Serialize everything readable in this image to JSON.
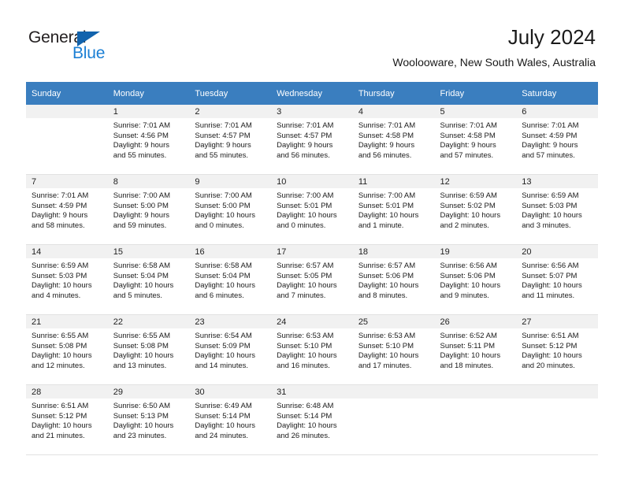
{
  "brand": {
    "name_top": "General",
    "name_bottom": "Blue",
    "triangle_icon": "triangle-icon",
    "color_dark": "#231f20",
    "color_blue": "#1b7fd4",
    "color_triangle": "#1263ad"
  },
  "header": {
    "title": "July 2024",
    "subtitle": "Woolooware, New South Wales, Australia",
    "header_bg": "#3a7ebf",
    "daynum_band_bg": "#f1f1f1"
  },
  "weekdays": [
    "Sunday",
    "Monday",
    "Tuesday",
    "Wednesday",
    "Thursday",
    "Friday",
    "Saturday"
  ],
  "weeks": [
    [
      {
        "day": "",
        "lines": []
      },
      {
        "day": "1",
        "lines": [
          "Sunrise: 7:01 AM",
          "Sunset: 4:56 PM",
          "Daylight: 9 hours",
          "and 55 minutes."
        ]
      },
      {
        "day": "2",
        "lines": [
          "Sunrise: 7:01 AM",
          "Sunset: 4:57 PM",
          "Daylight: 9 hours",
          "and 55 minutes."
        ]
      },
      {
        "day": "3",
        "lines": [
          "Sunrise: 7:01 AM",
          "Sunset: 4:57 PM",
          "Daylight: 9 hours",
          "and 56 minutes."
        ]
      },
      {
        "day": "4",
        "lines": [
          "Sunrise: 7:01 AM",
          "Sunset: 4:58 PM",
          "Daylight: 9 hours",
          "and 56 minutes."
        ]
      },
      {
        "day": "5",
        "lines": [
          "Sunrise: 7:01 AM",
          "Sunset: 4:58 PM",
          "Daylight: 9 hours",
          "and 57 minutes."
        ]
      },
      {
        "day": "6",
        "lines": [
          "Sunrise: 7:01 AM",
          "Sunset: 4:59 PM",
          "Daylight: 9 hours",
          "and 57 minutes."
        ]
      }
    ],
    [
      {
        "day": "7",
        "lines": [
          "Sunrise: 7:01 AM",
          "Sunset: 4:59 PM",
          "Daylight: 9 hours",
          "and 58 minutes."
        ]
      },
      {
        "day": "8",
        "lines": [
          "Sunrise: 7:00 AM",
          "Sunset: 5:00 PM",
          "Daylight: 9 hours",
          "and 59 minutes."
        ]
      },
      {
        "day": "9",
        "lines": [
          "Sunrise: 7:00 AM",
          "Sunset: 5:00 PM",
          "Daylight: 10 hours",
          "and 0 minutes."
        ]
      },
      {
        "day": "10",
        "lines": [
          "Sunrise: 7:00 AM",
          "Sunset: 5:01 PM",
          "Daylight: 10 hours",
          "and 0 minutes."
        ]
      },
      {
        "day": "11",
        "lines": [
          "Sunrise: 7:00 AM",
          "Sunset: 5:01 PM",
          "Daylight: 10 hours",
          "and 1 minute."
        ]
      },
      {
        "day": "12",
        "lines": [
          "Sunrise: 6:59 AM",
          "Sunset: 5:02 PM",
          "Daylight: 10 hours",
          "and 2 minutes."
        ]
      },
      {
        "day": "13",
        "lines": [
          "Sunrise: 6:59 AM",
          "Sunset: 5:03 PM",
          "Daylight: 10 hours",
          "and 3 minutes."
        ]
      }
    ],
    [
      {
        "day": "14",
        "lines": [
          "Sunrise: 6:59 AM",
          "Sunset: 5:03 PM",
          "Daylight: 10 hours",
          "and 4 minutes."
        ]
      },
      {
        "day": "15",
        "lines": [
          "Sunrise: 6:58 AM",
          "Sunset: 5:04 PM",
          "Daylight: 10 hours",
          "and 5 minutes."
        ]
      },
      {
        "day": "16",
        "lines": [
          "Sunrise: 6:58 AM",
          "Sunset: 5:04 PM",
          "Daylight: 10 hours",
          "and 6 minutes."
        ]
      },
      {
        "day": "17",
        "lines": [
          "Sunrise: 6:57 AM",
          "Sunset: 5:05 PM",
          "Daylight: 10 hours",
          "and 7 minutes."
        ]
      },
      {
        "day": "18",
        "lines": [
          "Sunrise: 6:57 AM",
          "Sunset: 5:06 PM",
          "Daylight: 10 hours",
          "and 8 minutes."
        ]
      },
      {
        "day": "19",
        "lines": [
          "Sunrise: 6:56 AM",
          "Sunset: 5:06 PM",
          "Daylight: 10 hours",
          "and 9 minutes."
        ]
      },
      {
        "day": "20",
        "lines": [
          "Sunrise: 6:56 AM",
          "Sunset: 5:07 PM",
          "Daylight: 10 hours",
          "and 11 minutes."
        ]
      }
    ],
    [
      {
        "day": "21",
        "lines": [
          "Sunrise: 6:55 AM",
          "Sunset: 5:08 PM",
          "Daylight: 10 hours",
          "and 12 minutes."
        ]
      },
      {
        "day": "22",
        "lines": [
          "Sunrise: 6:55 AM",
          "Sunset: 5:08 PM",
          "Daylight: 10 hours",
          "and 13 minutes."
        ]
      },
      {
        "day": "23",
        "lines": [
          "Sunrise: 6:54 AM",
          "Sunset: 5:09 PM",
          "Daylight: 10 hours",
          "and 14 minutes."
        ]
      },
      {
        "day": "24",
        "lines": [
          "Sunrise: 6:53 AM",
          "Sunset: 5:10 PM",
          "Daylight: 10 hours",
          "and 16 minutes."
        ]
      },
      {
        "day": "25",
        "lines": [
          "Sunrise: 6:53 AM",
          "Sunset: 5:10 PM",
          "Daylight: 10 hours",
          "and 17 minutes."
        ]
      },
      {
        "day": "26",
        "lines": [
          "Sunrise: 6:52 AM",
          "Sunset: 5:11 PM",
          "Daylight: 10 hours",
          "and 18 minutes."
        ]
      },
      {
        "day": "27",
        "lines": [
          "Sunrise: 6:51 AM",
          "Sunset: 5:12 PM",
          "Daylight: 10 hours",
          "and 20 minutes."
        ]
      }
    ],
    [
      {
        "day": "28",
        "lines": [
          "Sunrise: 6:51 AM",
          "Sunset: 5:12 PM",
          "Daylight: 10 hours",
          "and 21 minutes."
        ]
      },
      {
        "day": "29",
        "lines": [
          "Sunrise: 6:50 AM",
          "Sunset: 5:13 PM",
          "Daylight: 10 hours",
          "and 23 minutes."
        ]
      },
      {
        "day": "30",
        "lines": [
          "Sunrise: 6:49 AM",
          "Sunset: 5:14 PM",
          "Daylight: 10 hours",
          "and 24 minutes."
        ]
      },
      {
        "day": "31",
        "lines": [
          "Sunrise: 6:48 AM",
          "Sunset: 5:14 PM",
          "Daylight: 10 hours",
          "and 26 minutes."
        ]
      },
      {
        "day": "",
        "lines": []
      },
      {
        "day": "",
        "lines": []
      },
      {
        "day": "",
        "lines": []
      }
    ]
  ]
}
